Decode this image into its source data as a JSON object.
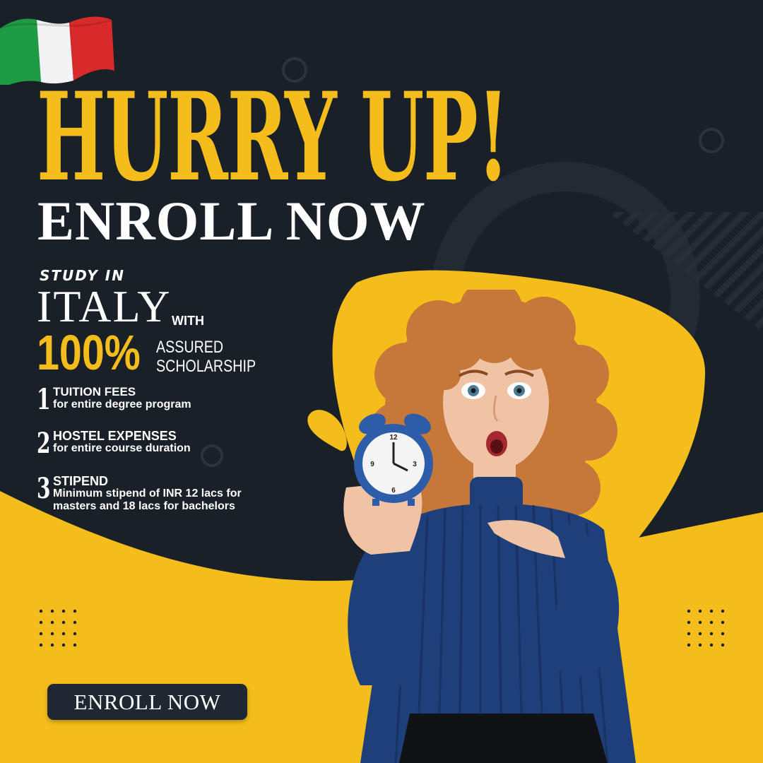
{
  "colors": {
    "background": "#1a2028",
    "accent_yellow": "#f4bd1b",
    "text_white": "#ffffff",
    "button_bg": "#1f2733",
    "flag_green": "#1f9a45",
    "flag_white": "#f2f2f2",
    "flag_red": "#d82a2a",
    "sweater_blue": "#1f3f7a",
    "clock_blue": "#2d5da8",
    "hair": "#c6773a",
    "skin": "#f1c3a5"
  },
  "headline": "HURRY UP!",
  "subheadline": "ENROLL NOW",
  "study": {
    "prefix": "STUDY IN",
    "country": "ITALY",
    "with": "WITH",
    "percent": "100%",
    "assured": "ASSURED",
    "scholarship": "SCHOLARSHIP"
  },
  "benefits": [
    {
      "num": "1",
      "title": "TUITION FEES",
      "lines": [
        "for entire degree program"
      ]
    },
    {
      "num": "2",
      "title": "HOSTEL EXPENSES",
      "lines": [
        "for entire course duration"
      ]
    },
    {
      "num": "3",
      "title": "STIPEND",
      "lines": [
        "Minimum stipend of INR 12 lacs for",
        "masters and 18 lacs for bachelors"
      ]
    }
  ],
  "cta_label": "ENROLL NOW",
  "icons": [
    "italy-flag-icon",
    "alarm-clock-icon",
    "dot-grid-icon"
  ]
}
